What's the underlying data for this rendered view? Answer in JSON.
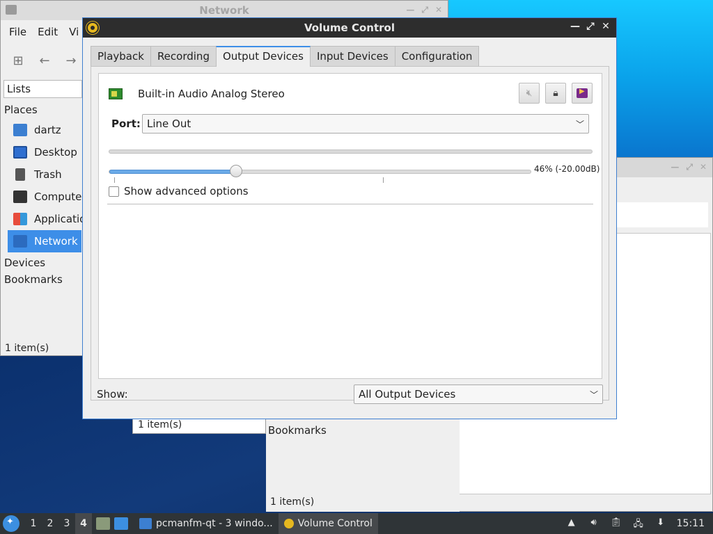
{
  "file_manager": {
    "title": "Network",
    "menu": [
      "File",
      "Edit",
      "Vi"
    ],
    "lists_label": "Lists",
    "places_header": "Places",
    "places": [
      "dartz",
      "Desktop",
      "Trash",
      "Computer",
      "Applicatio",
      "Network"
    ],
    "devices_header": "Devices",
    "bookmarks_header": "Bookmarks",
    "status": "1 item(s)"
  },
  "background_window_2": {
    "status_left": "1 item(s)",
    "bookmarks_header": "Bookmarks",
    "status": "1 item(s)"
  },
  "volume_control": {
    "title": "Volume Control",
    "tabs": [
      "Playback",
      "Recording",
      "Output Devices",
      "Input Devices",
      "Configuration"
    ],
    "active_tab": "Output Devices",
    "device_name": "Built-in Audio Analog Stereo",
    "port_label": "Port:",
    "port_value": "Line Out",
    "volume_fraction": 0.3,
    "volume_text": "46% (-20.00dB)",
    "advanced_label": "Show advanced options",
    "advanced_checked": false,
    "show_label": "Show:",
    "show_value": "All Output Devices"
  },
  "taskbar": {
    "workspaces": [
      "1",
      "2",
      "3",
      "4"
    ],
    "active_workspace": "4",
    "tasks": [
      "pcmanfm-qt - 3 windo...",
      "Volume Control"
    ],
    "clock": "15:11"
  },
  "colors": {
    "accent": "#3d8ee8",
    "titlebar_dark": "#2d2d2d",
    "taskbar": "#2f3437"
  }
}
